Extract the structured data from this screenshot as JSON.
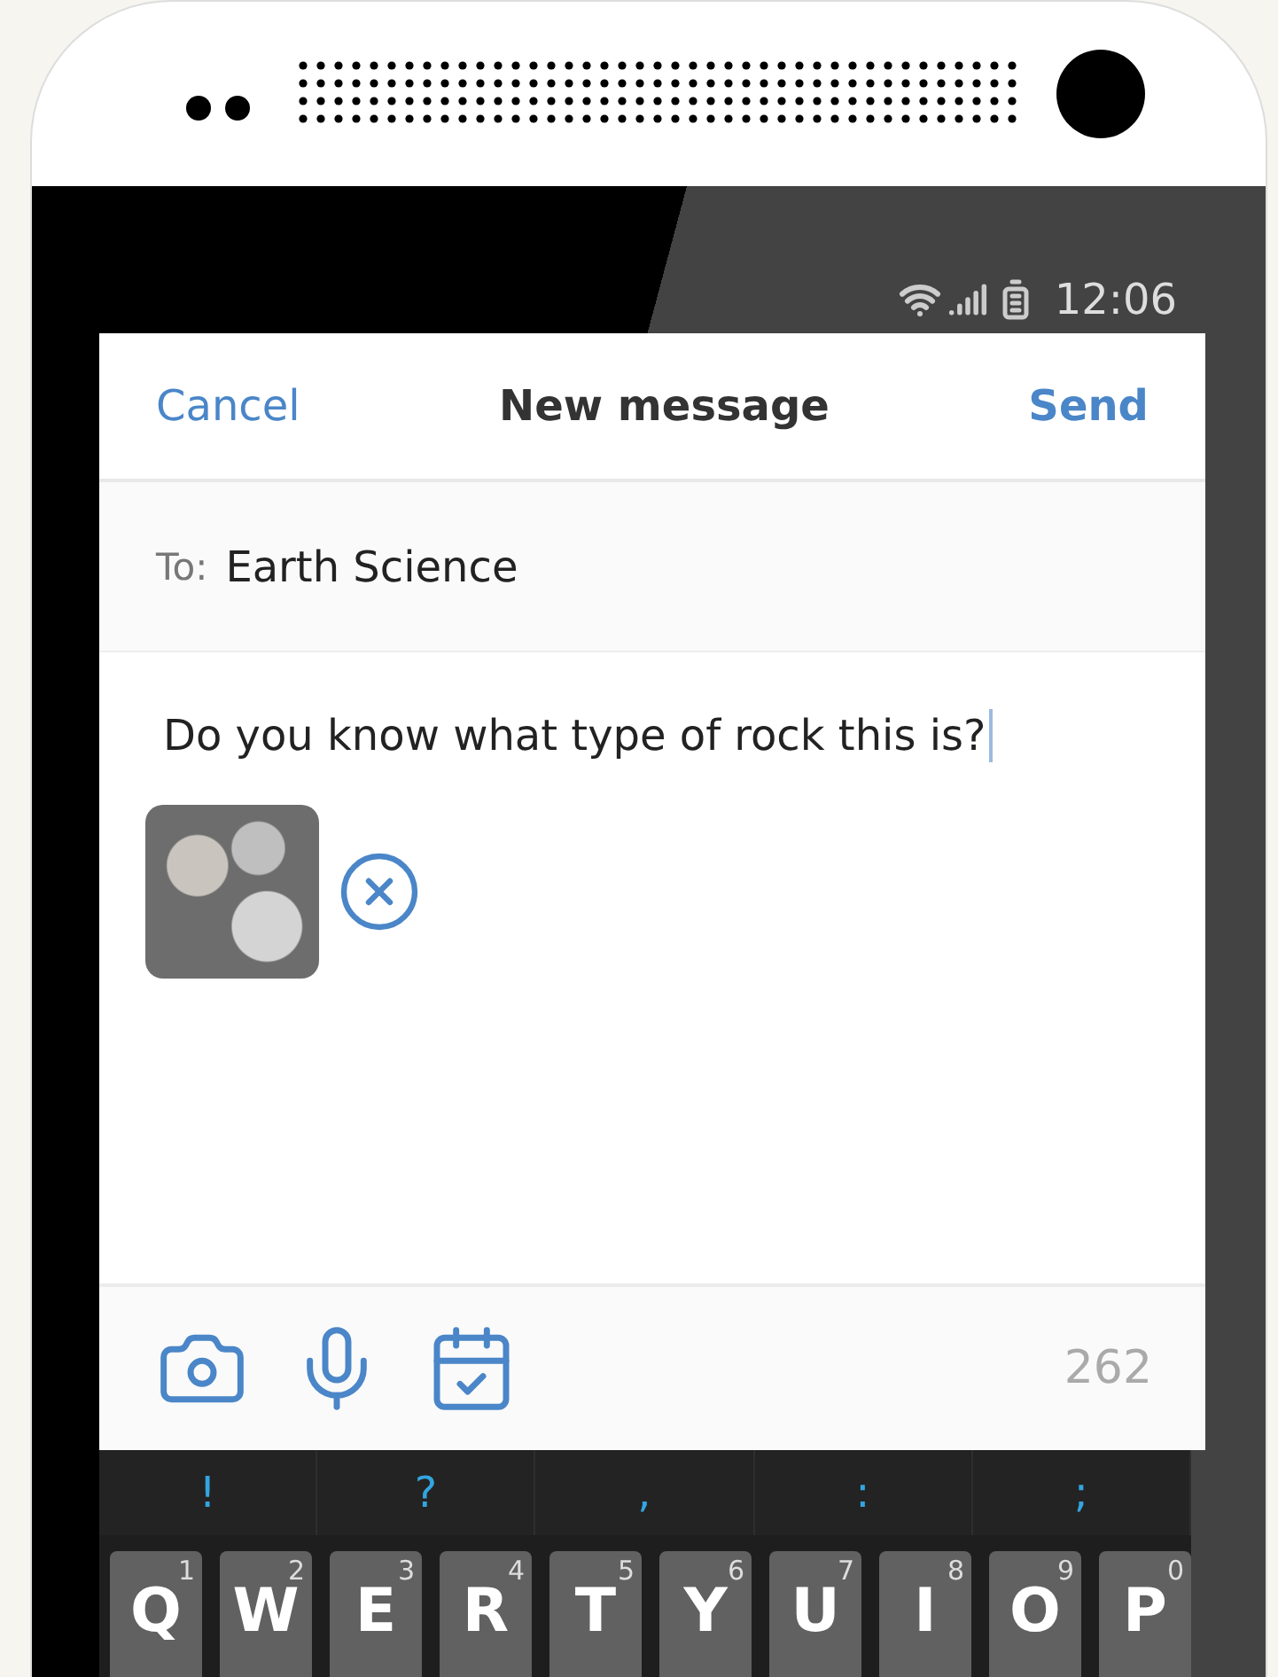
{
  "status_bar": {
    "time": "12:06"
  },
  "header": {
    "cancel": "Cancel",
    "title": "New message",
    "send": "Send"
  },
  "recipient": {
    "label": "To:",
    "value": "Earth Science"
  },
  "message": {
    "value": "Do you know what type of rock this is?"
  },
  "toolbar": {
    "counter": "262"
  },
  "keyboard": {
    "suggestions": [
      "!",
      "?",
      ",",
      ":",
      ";"
    ],
    "keys": [
      {
        "letter": "Q",
        "number": "1"
      },
      {
        "letter": "W",
        "number": "2"
      },
      {
        "letter": "E",
        "number": "3"
      },
      {
        "letter": "R",
        "number": "4"
      },
      {
        "letter": "T",
        "number": "5"
      },
      {
        "letter": "Y",
        "number": "6"
      },
      {
        "letter": "U",
        "number": "7"
      },
      {
        "letter": "I",
        "number": "8"
      },
      {
        "letter": "O",
        "number": "9"
      },
      {
        "letter": "P",
        "number": "0"
      }
    ]
  }
}
